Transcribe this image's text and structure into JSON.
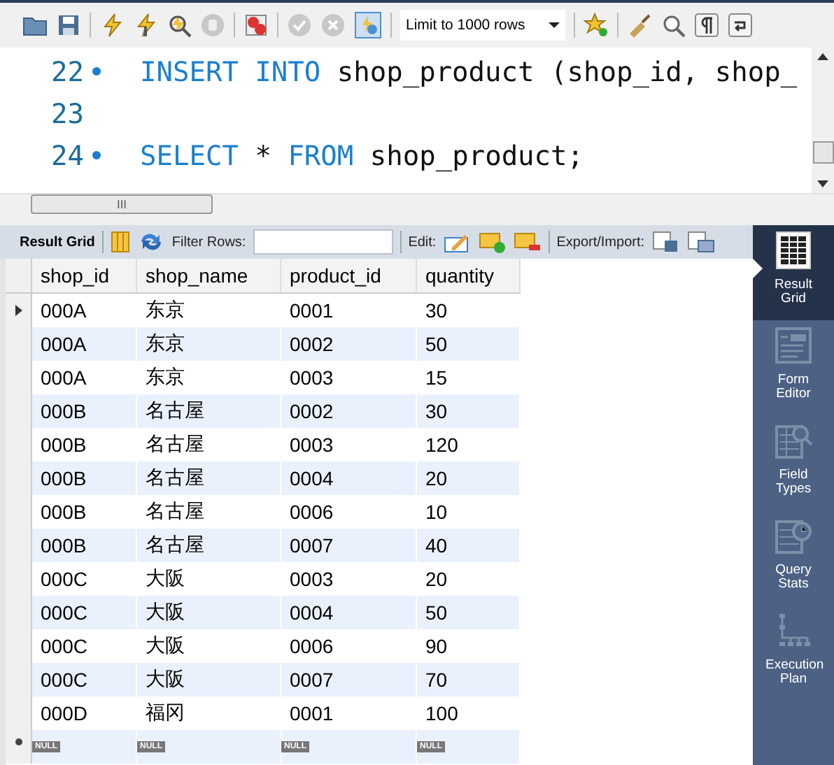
{
  "toolbar": {
    "limit": "Limit to 1000 rows"
  },
  "editor": {
    "lines": [
      {
        "number": "22",
        "statement": true,
        "tokens": [
          {
            "kind": "keyword",
            "text": "INSERT INTO"
          },
          {
            "kind": "plain",
            "text": " shop_product (shop_id, shop_"
          }
        ]
      },
      {
        "number": "23",
        "statement": false
      },
      {
        "number": "24",
        "statement": true,
        "tokens": [
          {
            "kind": "keyword",
            "text": "SELECT"
          },
          {
            "kind": "plain",
            "text": " * "
          },
          {
            "kind": "keyword",
            "text": "FROM"
          },
          {
            "kind": "plain",
            "text": " shop_product;"
          }
        ]
      }
    ],
    "hscroll_thumb": "III"
  },
  "result_toolbar": {
    "title": "Result Grid",
    "filter_label": "Filter Rows:",
    "edit_label": "Edit:",
    "export_label": "Export/Import:"
  },
  "table": {
    "columns": [
      "shop_id",
      "shop_name",
      "product_id",
      "quantity"
    ],
    "rows": [
      {
        "cells": [
          "000A",
          "东京",
          "0001",
          "30"
        ],
        "current": true
      },
      {
        "cells": [
          "000A",
          "东京",
          "0002",
          "50"
        ],
        "current": false
      },
      {
        "cells": [
          "000A",
          "东京",
          "0003",
          "15"
        ],
        "current": false
      },
      {
        "cells": [
          "000B",
          "名古屋",
          "0002",
          "30"
        ],
        "current": false
      },
      {
        "cells": [
          "000B",
          "名古屋",
          "0003",
          "120"
        ],
        "current": false
      },
      {
        "cells": [
          "000B",
          "名古屋",
          "0004",
          "20"
        ],
        "current": false
      },
      {
        "cells": [
          "000B",
          "名古屋",
          "0006",
          "10"
        ],
        "current": false
      },
      {
        "cells": [
          "000B",
          "名古屋",
          "0007",
          "40"
        ],
        "current": false
      },
      {
        "cells": [
          "000C",
          "大阪",
          "0003",
          "20"
        ],
        "current": false
      },
      {
        "cells": [
          "000C",
          "大阪",
          "0004",
          "50"
        ],
        "current": false
      },
      {
        "cells": [
          "000C",
          "大阪",
          "0006",
          "90"
        ],
        "current": false
      },
      {
        "cells": [
          "000C",
          "大阪",
          "0007",
          "70"
        ],
        "current": false
      },
      {
        "cells": [
          "000D",
          "福冈",
          "0001",
          "100"
        ],
        "current": false
      }
    ],
    "new_row": [
      "NULL",
      "NULL",
      "NULL",
      "NULL"
    ]
  },
  "side_panel": [
    {
      "kind": "grid",
      "label": "Result Grid",
      "selected": true
    },
    {
      "kind": "form",
      "label": "Form Editor",
      "selected": false
    },
    {
      "kind": "types",
      "label": "Field Types",
      "selected": false
    },
    {
      "kind": "stats",
      "label": "Query Stats",
      "selected": false
    },
    {
      "kind": "plan",
      "label": "Execution Plan",
      "selected": false
    }
  ]
}
